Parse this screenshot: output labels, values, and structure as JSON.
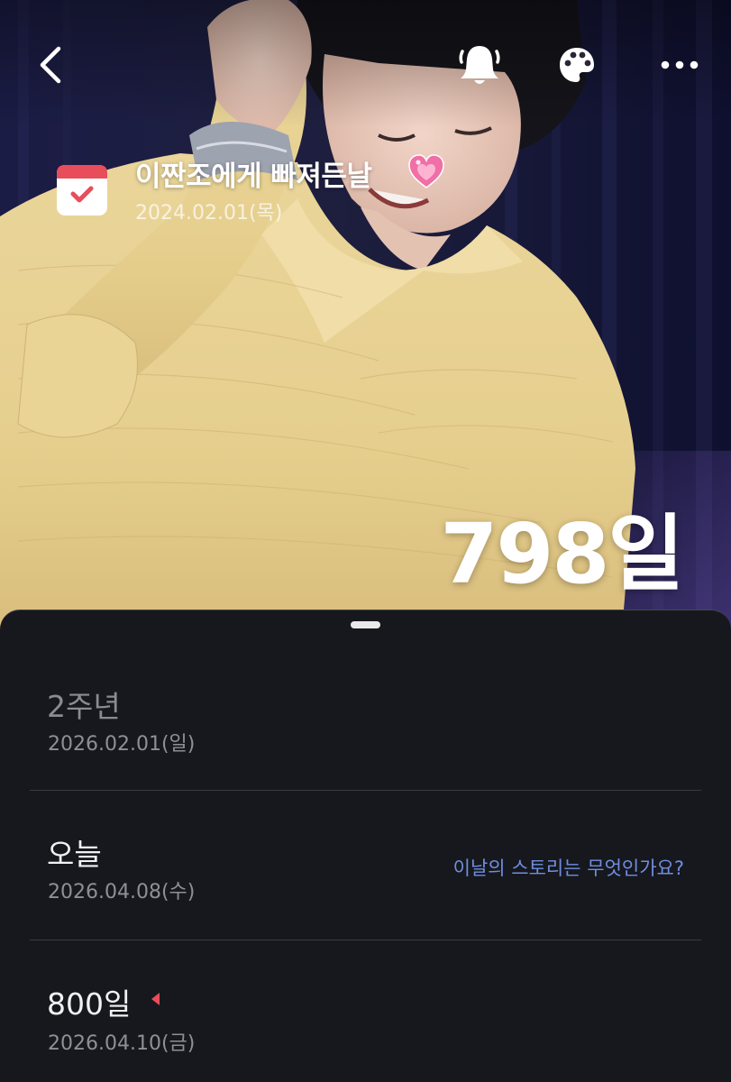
{
  "hero": {
    "photo": "photo-of-person-in-yellow-knit-sweater-laughing",
    "title": "이짠조에게 빠져든날",
    "title_emoji": "heart-icon",
    "date": "2024.02.01(목)",
    "day_count": "798일"
  },
  "top_bar": {
    "back_icon": "chevron-left-icon",
    "bell_icon": "bell-icon",
    "palette_icon": "palette-icon",
    "more_icon": "more-icon"
  },
  "rows": [
    {
      "title": "2주년",
      "date": "2026.02.01(일)",
      "state": "past"
    },
    {
      "title": "오늘",
      "date": "2026.04.08(수)",
      "link": "이날의 스토리는 무엇인가요?"
    },
    {
      "title": "800일",
      "date": "2026.04.10(금)",
      "marker_icon": "flag-icon"
    }
  ],
  "colors": {
    "background": "#17181d",
    "link": "#6f8ee0",
    "muted_text": "#8e8f97",
    "calendar_red": "#e84d5b",
    "heart_pink": "#f06fa7"
  }
}
